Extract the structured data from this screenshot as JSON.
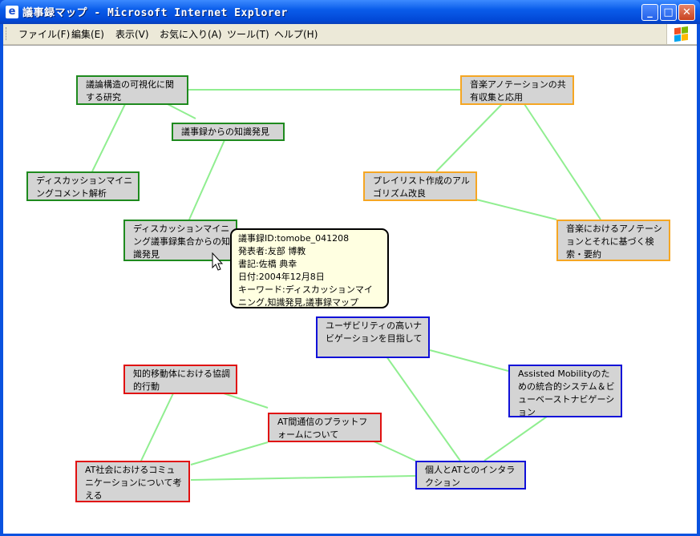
{
  "window": {
    "title": "議事録マップ - Microsoft Internet Explorer",
    "controls": {
      "minimize": "_",
      "maximize": "□",
      "close": "✕"
    }
  },
  "menu": {
    "items": [
      "ファイル(F)",
      "編集(E)",
      "表示(V)",
      "お気に入り(A)",
      "ツール(T)",
      "ヘルプ(H)"
    ]
  },
  "colors": {
    "edge": "#90ee90",
    "green": "#1e8a1e",
    "orange": "#f5a623",
    "blue": "#1010d8",
    "red": "#e01010",
    "node_fill": "#d4d4d4",
    "tooltip_fill": "#ffffe1"
  },
  "nodes": {
    "n1": {
      "text": "議論構造の可視化に関する研究",
      "group": "green"
    },
    "n2": {
      "text": "議事録からの知識発見",
      "group": "green"
    },
    "n3": {
      "text": "ディスカッションマイニングコメント解析",
      "group": "green"
    },
    "n4": {
      "text": "ディスカッションマイニング議事録集合からの知識発見",
      "group": "green"
    },
    "n5": {
      "text": "音楽アノテーションの共有収集と応用",
      "group": "orange"
    },
    "n6": {
      "text": "プレイリスト作成のアルゴリズム改良",
      "group": "orange"
    },
    "n7": {
      "text": "音楽におけるアノテーションとそれに基づく検索・要約",
      "group": "orange"
    },
    "n8": {
      "text": "ユーザビリティの高いナビゲーションを目指して",
      "group": "blue"
    },
    "n9": {
      "text": "Assisted Mobilityのための統合的システム＆ビューベーストナビゲーション",
      "group": "blue"
    },
    "n10": {
      "text": "個人とATとのインタラクション",
      "group": "blue"
    },
    "n11": {
      "text": "知的移動体における協調的行動",
      "group": "red"
    },
    "n12": {
      "text": "AT間通信のプラットフォームについて",
      "group": "red"
    },
    "n13": {
      "text": "AT社会におけるコミュニケーションについて考える",
      "group": "red"
    }
  },
  "tooltip": {
    "lines": [
      "議事録ID:tomobe_041208",
      "発表者:友部 博教",
      "書記:佐橋 典幸",
      "日付:2004年12月8日",
      "キーワード:ディスカッションマイニング,知識発見,議事録マップ"
    ]
  },
  "icons": {
    "title": "ie-page-icon",
    "logo": "windows-flag-icon",
    "cursor": "arrow-cursor-icon"
  }
}
